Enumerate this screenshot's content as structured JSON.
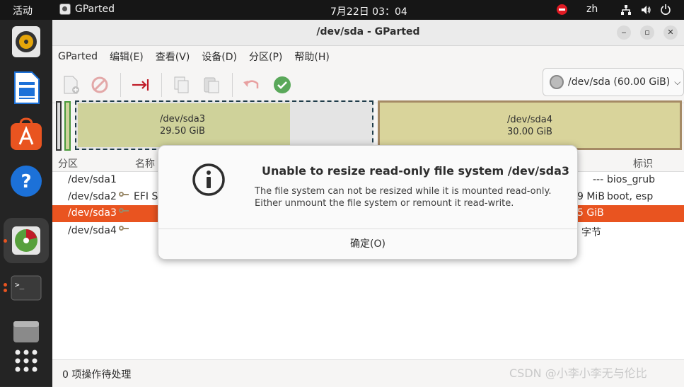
{
  "topbar": {
    "activities": "活动",
    "app_name": "GParted",
    "clock": "7月22日 03：04",
    "lang": "zh"
  },
  "window": {
    "title": "/dev/sda - GParted",
    "menu": [
      "GParted",
      "编辑(E)",
      "查看(V)",
      "设备(D)",
      "分区(P)",
      "帮助(H)"
    ],
    "device_selector": "/dev/sda (60.00 GiB)"
  },
  "graph": {
    "sda3": {
      "name": "/dev/sda3",
      "size": "29.50 GiB"
    },
    "sda4": {
      "name": "/dev/sda4",
      "size": "30.00 GiB"
    }
  },
  "table": {
    "headers": {
      "partition": "分区",
      "name": "名称",
      "flags": "标识"
    },
    "rows": [
      {
        "partition": "/dev/sda1",
        "name": "",
        "right": "---",
        "flags": "bios_grub"
      },
      {
        "partition": "/dev/sda2",
        "name": "EFI Sy",
        "right": "9 MiB",
        "flags": "boot, esp"
      },
      {
        "partition": "/dev/sda3",
        "name": "",
        "right": "5 GiB",
        "flags": ""
      },
      {
        "partition": "/dev/sda4",
        "name": "",
        "right": "字节",
        "flags": ""
      }
    ]
  },
  "status": {
    "pending": "0 项操作待处理"
  },
  "watermark": "CSDN @小李小李无与伦比",
  "dialog": {
    "title": "Unable to resize read-only file system /dev/sda3",
    "line1": "The file system can not be resized while it is mounted read-only.",
    "line2": "Either unmount the file system or remount it read-write.",
    "ok": "确定(O)"
  },
  "colors": {
    "accent": "#e95420",
    "used": "#cfd29a",
    "ext4": "#a58a65"
  }
}
